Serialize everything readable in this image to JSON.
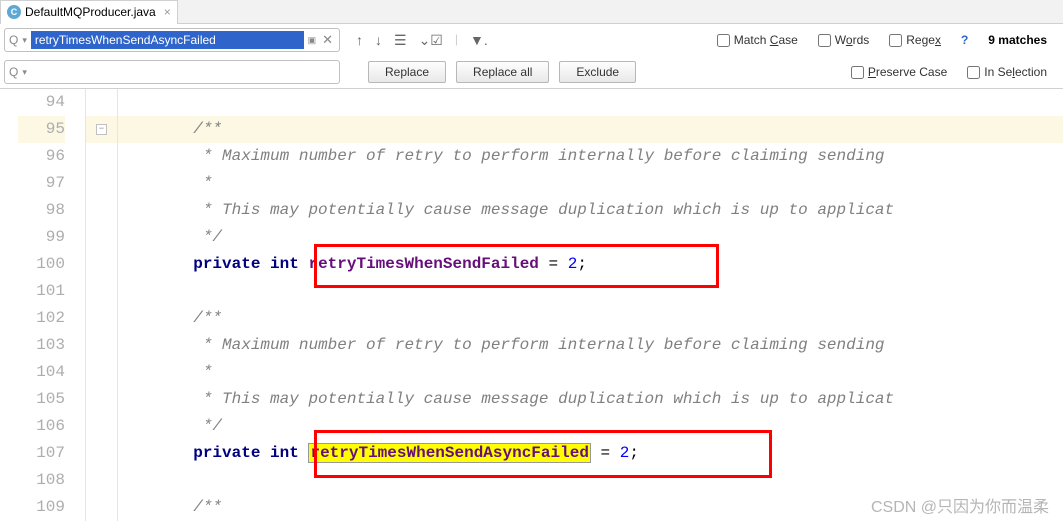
{
  "tab": {
    "filename": "DefaultMQProducer.java",
    "icon_letter": "C"
  },
  "search": {
    "query": "retryTimesWhenSendAsyncFailed",
    "match_case": "Match Case",
    "words": "Words",
    "regex": "Regex",
    "help": "?",
    "matches_label": "9 matches"
  },
  "replace": {
    "replace_btn": "Replace",
    "replace_all_btn": "Replace all",
    "exclude_btn": "Exclude",
    "preserve_case": "Preserve Case",
    "in_selection": "In Selection"
  },
  "code": {
    "lines": {
      "94": "94",
      "95": "95",
      "96": "96",
      "97": "97",
      "98": "98",
      "99": "99",
      "100": "100",
      "101": "101",
      "102": "102",
      "103": "103",
      "104": "104",
      "105": "105",
      "106": "106",
      "107": "107",
      "108": "108",
      "109": "109"
    },
    "l95": "/**",
    "l96": " * Maximum number of retry to perform internally before claiming sending",
    "l97": " *",
    "l98": " * This may potentially cause message duplication which is up to applicat",
    "l99": " */",
    "l100_private": "private",
    "l100_int": "int",
    "l100_field": "retryTimesWhenSendFailed",
    "l100_eq": " = ",
    "l100_val": "2",
    "l100_semi": ";",
    "l102": "/**",
    "l103": " * Maximum number of retry to perform internally before claiming sending",
    "l104": " *",
    "l105": " * This may potentially cause message duplication which is up to applicat",
    "l106": " */",
    "l107_private": "private",
    "l107_int": "int",
    "l107_field": "retryTimesWhenSendAsyncFailed",
    "l107_eq": " = ",
    "l107_val": "2",
    "l107_semi": ";",
    "l109": "/**"
  },
  "watermark": "CSDN @只因为你而温柔"
}
